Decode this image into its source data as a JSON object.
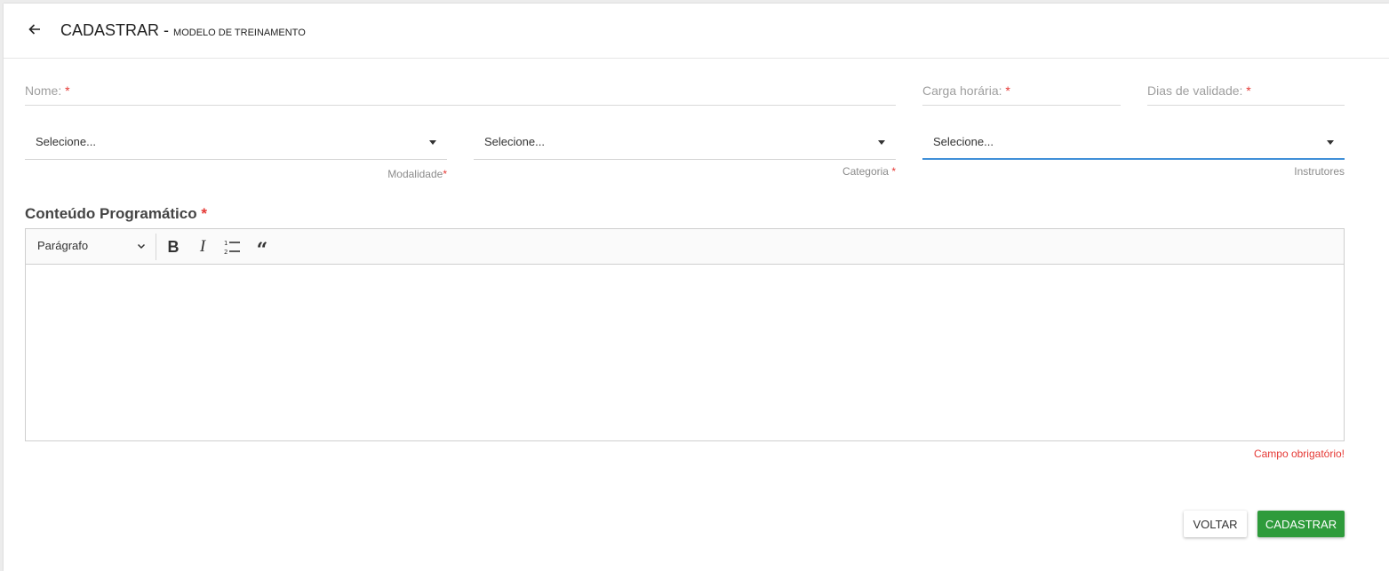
{
  "header": {
    "title": "CADASTRAR -",
    "subtitle": "MODELO DE TREINAMENTO"
  },
  "fields": {
    "nome": {
      "label": "Nome:",
      "required": "*"
    },
    "carga": {
      "label": "Carga horária:",
      "required": "*"
    },
    "dias": {
      "label": "Dias de validade:",
      "required": "*"
    }
  },
  "selects": {
    "modalidade": {
      "value": "Selecione...",
      "helper": "Modalidade",
      "required": "*"
    },
    "categoria": {
      "value": "Selecione...",
      "helper": "Categoria",
      "required": "*"
    },
    "instrutores": {
      "value": "Selecione...",
      "helper": "Instrutores"
    }
  },
  "content_section": {
    "title": "Conteúdo Programático",
    "required": "*"
  },
  "editor": {
    "paragraph_label": "Parágrafo",
    "icons": [
      "chevron-down-icon",
      "bold-icon",
      "italic-icon",
      "numbered-list-icon",
      "blockquote-icon"
    ],
    "content": ""
  },
  "error": "Campo obrigatório!",
  "actions": {
    "voltar": "VOLTAR",
    "cadastrar": "CADASTRAR"
  },
  "colors": {
    "accent": "#3f8fd8",
    "required": "#e53935",
    "primary_button": "#2e9b3b"
  }
}
